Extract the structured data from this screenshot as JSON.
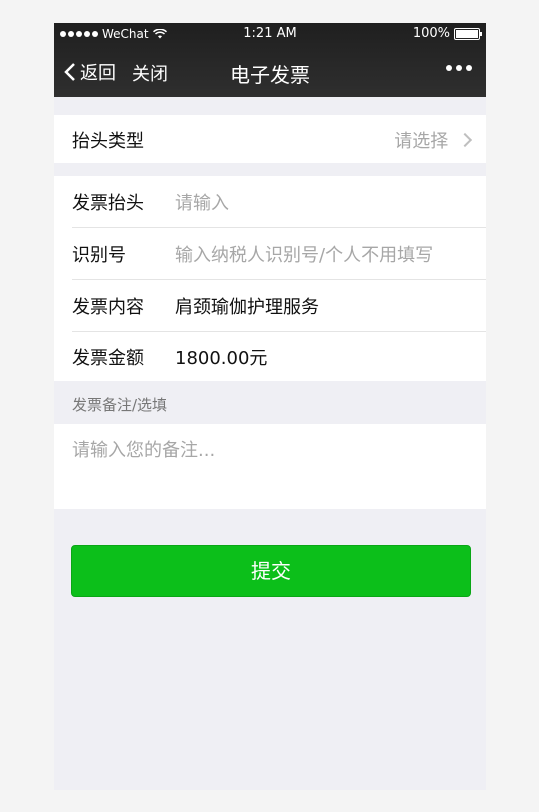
{
  "status_bar": {
    "carrier": "WeChat",
    "time": "1:21 AM",
    "battery": "100%"
  },
  "nav": {
    "back_label": "返回",
    "close_label": "关闭",
    "title": "电子发票"
  },
  "form": {
    "header_type": {
      "label": "抬头类型",
      "value": "请选择"
    },
    "invoice_header": {
      "label": "发票抬头",
      "placeholder": "请输入"
    },
    "tax_id": {
      "label": "识别号",
      "placeholder": "输入纳税人识别号/个人不用填写"
    },
    "content": {
      "label": "发票内容",
      "value": "肩颈瑜伽护理服务"
    },
    "amount": {
      "label": "发票金额",
      "value": "1800.00元"
    },
    "remark_section_label": "发票备注/选填",
    "remark_placeholder": "请输入您的备注..."
  },
  "submit_label": "提交",
  "colors": {
    "nav_bg": "#2a2a2a",
    "page_bg": "#efeff4",
    "primary_green": "#0cbf1a"
  }
}
